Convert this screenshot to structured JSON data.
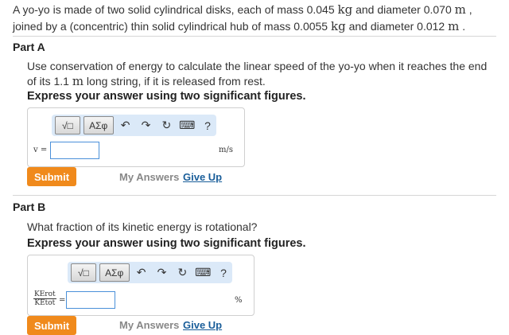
{
  "problem": {
    "t1": "A yo-yo is made of two solid cylindrical disks, each of mass 0.045 ",
    "u1": "kg",
    "t2": " and diameter 0.070 ",
    "u2": "m",
    "t3": " , joined by a (concentric) thin solid cylindrical hub of mass 0.0055 ",
    "u3": "kg",
    "t4": " and diameter 0.012 ",
    "u4": "m",
    "t5": " ."
  },
  "partA": {
    "title": "Part A",
    "question_a": "Use conservation of energy to calculate the linear speed of the yo-yo when it reaches the end of its 1.1 ",
    "question_unit": "m",
    "question_b": " long string, if it is released from rest.",
    "instruction": "Express your answer using two significant figures.",
    "toolbar": {
      "sqrt_label": "√□",
      "greek_label": "ΑΣφ",
      "undo": "↶",
      "redo": "↷",
      "reset": "↻",
      "keyboard": "⌨",
      "help": "?"
    },
    "variable_label": "v =",
    "input_value": "",
    "unit": "m/s",
    "submit_label": "Submit",
    "my_answers": "My Answers",
    "give_up": "Give Up"
  },
  "partB": {
    "title": "Part B",
    "question": "What fraction of its kinetic energy is rotational?",
    "instruction": "Express your answer using two significant figures.",
    "toolbar": {
      "sqrt_label": "√□",
      "greek_label": "ΑΣφ",
      "undo": "↶",
      "redo": "↷",
      "reset": "↻",
      "keyboard": "⌨",
      "help": "?"
    },
    "fraction_num": "KErot",
    "fraction_den": "KEtot",
    "equals": "=",
    "input_value": "",
    "unit": "%",
    "submit_label": "Submit",
    "my_answers": "My Answers",
    "give_up": "Give Up"
  },
  "colors": {
    "submit": "#f08a1c",
    "link": "#1a5e9a",
    "toolbar": "#dbe9f8",
    "input_border": "#4a90d9"
  }
}
